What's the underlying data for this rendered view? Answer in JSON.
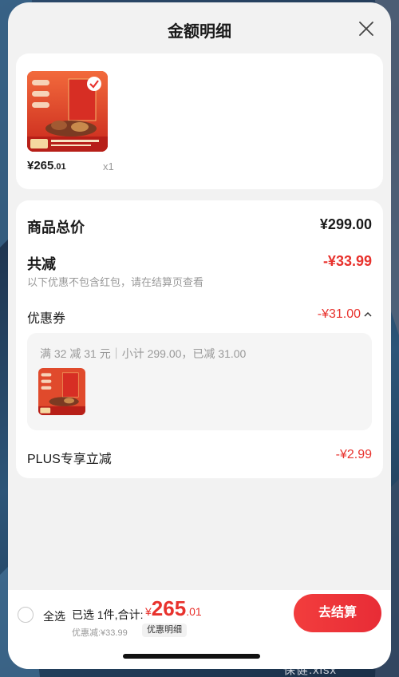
{
  "header": {
    "title": "金额明细"
  },
  "product": {
    "price_int": "¥265",
    "price_dec": ".01",
    "quantity": "x1",
    "thumb_texts": {
      "brand": "京东京造",
      "tag1": "新年礼盒",
      "tag2": "精选滋补食材 还有650g"
    }
  },
  "summary": {
    "total_label": "商品总价",
    "total_value": "¥299.00",
    "reduce_label": "共减",
    "reduce_value": "-¥33.99",
    "reduce_note": "以下优惠不包含红包，请在结算页查看",
    "coupon_label": "优惠券",
    "coupon_value": "-¥31.00",
    "coupon_detail": "满 32 减 31 元｜小计 299.00，已减 31.00",
    "plus_label": "PLUS专享立减",
    "plus_value": "-¥2.99"
  },
  "footer": {
    "select_all": "全选",
    "selected_info": "已选 1件,合计:",
    "total_currency": "¥",
    "total_int": "265",
    "total_dec": ".01",
    "discount_line": "优惠减:¥33.99",
    "detail_chip": "优惠明细",
    "checkout": "去结算"
  },
  "background": {
    "file_label": "保健.xlsx"
  },
  "colors": {
    "accent_red": "#e8322d",
    "sheet_bg": "#f2f2f2"
  }
}
